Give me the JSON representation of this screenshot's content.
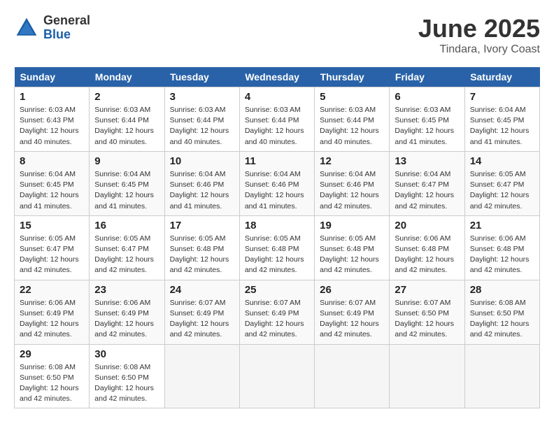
{
  "header": {
    "logo_general": "General",
    "logo_blue": "Blue",
    "month": "June 2025",
    "location": "Tindara, Ivory Coast"
  },
  "weekdays": [
    "Sunday",
    "Monday",
    "Tuesday",
    "Wednesday",
    "Thursday",
    "Friday",
    "Saturday"
  ],
  "weeks": [
    [
      {
        "day": "1",
        "info": "Sunrise: 6:03 AM\nSunset: 6:43 PM\nDaylight: 12 hours\nand 40 minutes."
      },
      {
        "day": "2",
        "info": "Sunrise: 6:03 AM\nSunset: 6:44 PM\nDaylight: 12 hours\nand 40 minutes."
      },
      {
        "day": "3",
        "info": "Sunrise: 6:03 AM\nSunset: 6:44 PM\nDaylight: 12 hours\nand 40 minutes."
      },
      {
        "day": "4",
        "info": "Sunrise: 6:03 AM\nSunset: 6:44 PM\nDaylight: 12 hours\nand 40 minutes."
      },
      {
        "day": "5",
        "info": "Sunrise: 6:03 AM\nSunset: 6:44 PM\nDaylight: 12 hours\nand 40 minutes."
      },
      {
        "day": "6",
        "info": "Sunrise: 6:03 AM\nSunset: 6:45 PM\nDaylight: 12 hours\nand 41 minutes."
      },
      {
        "day": "7",
        "info": "Sunrise: 6:04 AM\nSunset: 6:45 PM\nDaylight: 12 hours\nand 41 minutes."
      }
    ],
    [
      {
        "day": "8",
        "info": "Sunrise: 6:04 AM\nSunset: 6:45 PM\nDaylight: 12 hours\nand 41 minutes."
      },
      {
        "day": "9",
        "info": "Sunrise: 6:04 AM\nSunset: 6:45 PM\nDaylight: 12 hours\nand 41 minutes."
      },
      {
        "day": "10",
        "info": "Sunrise: 6:04 AM\nSunset: 6:46 PM\nDaylight: 12 hours\nand 41 minutes."
      },
      {
        "day": "11",
        "info": "Sunrise: 6:04 AM\nSunset: 6:46 PM\nDaylight: 12 hours\nand 41 minutes."
      },
      {
        "day": "12",
        "info": "Sunrise: 6:04 AM\nSunset: 6:46 PM\nDaylight: 12 hours\nand 42 minutes."
      },
      {
        "day": "13",
        "info": "Sunrise: 6:04 AM\nSunset: 6:47 PM\nDaylight: 12 hours\nand 42 minutes."
      },
      {
        "day": "14",
        "info": "Sunrise: 6:05 AM\nSunset: 6:47 PM\nDaylight: 12 hours\nand 42 minutes."
      }
    ],
    [
      {
        "day": "15",
        "info": "Sunrise: 6:05 AM\nSunset: 6:47 PM\nDaylight: 12 hours\nand 42 minutes."
      },
      {
        "day": "16",
        "info": "Sunrise: 6:05 AM\nSunset: 6:47 PM\nDaylight: 12 hours\nand 42 minutes."
      },
      {
        "day": "17",
        "info": "Sunrise: 6:05 AM\nSunset: 6:48 PM\nDaylight: 12 hours\nand 42 minutes."
      },
      {
        "day": "18",
        "info": "Sunrise: 6:05 AM\nSunset: 6:48 PM\nDaylight: 12 hours\nand 42 minutes."
      },
      {
        "day": "19",
        "info": "Sunrise: 6:05 AM\nSunset: 6:48 PM\nDaylight: 12 hours\nand 42 minutes."
      },
      {
        "day": "20",
        "info": "Sunrise: 6:06 AM\nSunset: 6:48 PM\nDaylight: 12 hours\nand 42 minutes."
      },
      {
        "day": "21",
        "info": "Sunrise: 6:06 AM\nSunset: 6:48 PM\nDaylight: 12 hours\nand 42 minutes."
      }
    ],
    [
      {
        "day": "22",
        "info": "Sunrise: 6:06 AM\nSunset: 6:49 PM\nDaylight: 12 hours\nand 42 minutes."
      },
      {
        "day": "23",
        "info": "Sunrise: 6:06 AM\nSunset: 6:49 PM\nDaylight: 12 hours\nand 42 minutes."
      },
      {
        "day": "24",
        "info": "Sunrise: 6:07 AM\nSunset: 6:49 PM\nDaylight: 12 hours\nand 42 minutes."
      },
      {
        "day": "25",
        "info": "Sunrise: 6:07 AM\nSunset: 6:49 PM\nDaylight: 12 hours\nand 42 minutes."
      },
      {
        "day": "26",
        "info": "Sunrise: 6:07 AM\nSunset: 6:49 PM\nDaylight: 12 hours\nand 42 minutes."
      },
      {
        "day": "27",
        "info": "Sunrise: 6:07 AM\nSunset: 6:50 PM\nDaylight: 12 hours\nand 42 minutes."
      },
      {
        "day": "28",
        "info": "Sunrise: 6:08 AM\nSunset: 6:50 PM\nDaylight: 12 hours\nand 42 minutes."
      }
    ],
    [
      {
        "day": "29",
        "info": "Sunrise: 6:08 AM\nSunset: 6:50 PM\nDaylight: 12 hours\nand 42 minutes."
      },
      {
        "day": "30",
        "info": "Sunrise: 6:08 AM\nSunset: 6:50 PM\nDaylight: 12 hours\nand 42 minutes."
      },
      {
        "day": "",
        "info": ""
      },
      {
        "day": "",
        "info": ""
      },
      {
        "day": "",
        "info": ""
      },
      {
        "day": "",
        "info": ""
      },
      {
        "day": "",
        "info": ""
      }
    ]
  ]
}
